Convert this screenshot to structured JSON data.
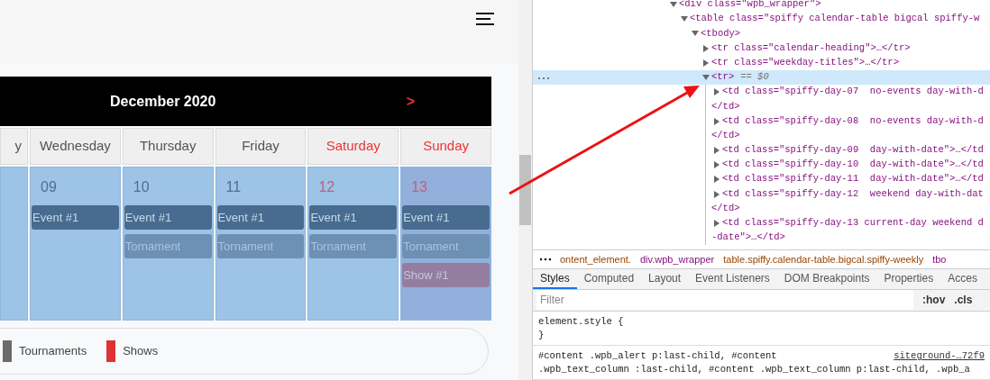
{
  "page": {
    "calendar": {
      "title": "December 2020",
      "next": ">",
      "weekdays": [
        {
          "label": "y",
          "weekend": false
        },
        {
          "label": "Wednesday",
          "weekend": false
        },
        {
          "label": "Thursday",
          "weekend": false
        },
        {
          "label": "Friday",
          "weekend": false
        },
        {
          "label": "Saturday",
          "weekend": true
        },
        {
          "label": "Sunday",
          "weekend": true
        }
      ],
      "days": [
        {
          "number": "09",
          "weekend": false,
          "current": false,
          "events": [
            {
              "label": "Event #1",
              "kind": "event"
            }
          ]
        },
        {
          "number": "10",
          "weekend": false,
          "current": false,
          "events": [
            {
              "label": "Event #1",
              "kind": "event"
            },
            {
              "label": "Tornament",
              "kind": "tournament"
            }
          ]
        },
        {
          "number": "11",
          "weekend": false,
          "current": false,
          "events": [
            {
              "label": "Event #1",
              "kind": "event"
            },
            {
              "label": "Tornament",
              "kind": "tournament"
            }
          ]
        },
        {
          "number": "12",
          "weekend": true,
          "current": false,
          "events": [
            {
              "label": "Event #1",
              "kind": "event"
            },
            {
              "label": "Tornament",
              "kind": "tournament"
            }
          ]
        },
        {
          "number": "13",
          "weekend": true,
          "current": true,
          "events": [
            {
              "label": "Event #1",
              "kind": "event"
            },
            {
              "label": "Tornament",
              "kind": "tournament"
            },
            {
              "label": "Show #1",
              "kind": "show"
            }
          ]
        }
      ]
    },
    "legend": [
      {
        "label": "Tournaments",
        "color": "#6b6b6b"
      },
      {
        "label": "Shows",
        "color": "#dd3333"
      }
    ]
  },
  "devtools": {
    "tree": [
      {
        "text": "<div class=\"wpb_wrapper\">",
        "expanded": true,
        "selected": false,
        "children": [
          {
            "text": "<table class=\"spiffy calendar-table bigcal spiffy-w",
            "expanded": true,
            "selected": false,
            "children": [
              {
                "text": "<tbody>",
                "expanded": true,
                "selected": false,
                "children": [
                  {
                    "text": "<tr class=\"calendar-heading\">…</tr>",
                    "expanded": false,
                    "selected": false
                  },
                  {
                    "text": "<tr class=\"weekday-titles\">…</tr>",
                    "expanded": false,
                    "selected": false
                  },
                  {
                    "text": "<tr>",
                    "marker": "== $0",
                    "expanded": true,
                    "selected": true,
                    "children": [
                      {
                        "text": "<td class=\"spiffy-day-07  no-events day-with-d",
                        "wrap": "</td>",
                        "expanded": false,
                        "selected": false
                      },
                      {
                        "text": "<td class=\"spiffy-day-08  no-events day-with-d",
                        "wrap": "</td>",
                        "expanded": false,
                        "selected": false
                      },
                      {
                        "text": "<td class=\"spiffy-day-09  day-with-date\">…</td",
                        "expanded": false,
                        "selected": false
                      },
                      {
                        "text": "<td class=\"spiffy-day-10  day-with-date\">…</td",
                        "expanded": false,
                        "selected": false
                      },
                      {
                        "text": "<td class=\"spiffy-day-11  day-with-date\">…</td",
                        "expanded": false,
                        "selected": false
                      },
                      {
                        "text": "<td class=\"spiffy-day-12  weekend day-with-dat",
                        "wrap": "</td>",
                        "expanded": false,
                        "selected": false
                      },
                      {
                        "text": "<td class=\"spiffy-day-13 current-day weekend d",
                        "wrap": "-date\">…</td>",
                        "expanded": false,
                        "selected": false
                      }
                    ]
                  }
                ]
              }
            ]
          }
        ]
      }
    ],
    "breadcrumbs": [
      "ontent_element.",
      "div.wpb_wrapper",
      "table.spiffy.calendar-table.bigcal.spiffy-weekly",
      "tbo"
    ],
    "tabs": [
      {
        "label": "Styles",
        "selected": true
      },
      {
        "label": "Computed",
        "selected": false
      },
      {
        "label": "Layout",
        "selected": false
      },
      {
        "label": "Event Listeners",
        "selected": false
      },
      {
        "label": "DOM Breakpoints",
        "selected": false
      },
      {
        "label": "Properties",
        "selected": false
      },
      {
        "label": "Acces",
        "selected": false
      }
    ],
    "filter": {
      "placeholder": "Filter"
    },
    "toggles": [
      ":hov",
      ".cls"
    ],
    "rules": [
      {
        "lines": [
          "element.style {",
          "}"
        ]
      },
      {
        "lines": [
          "#content .wpb_alert p:last-child, #content",
          ".wpb_text_column :last-child, #content .wpb_text_column p:last-child, .wpb_a"
        ],
        "source": "siteground-…72f9"
      }
    ]
  }
}
